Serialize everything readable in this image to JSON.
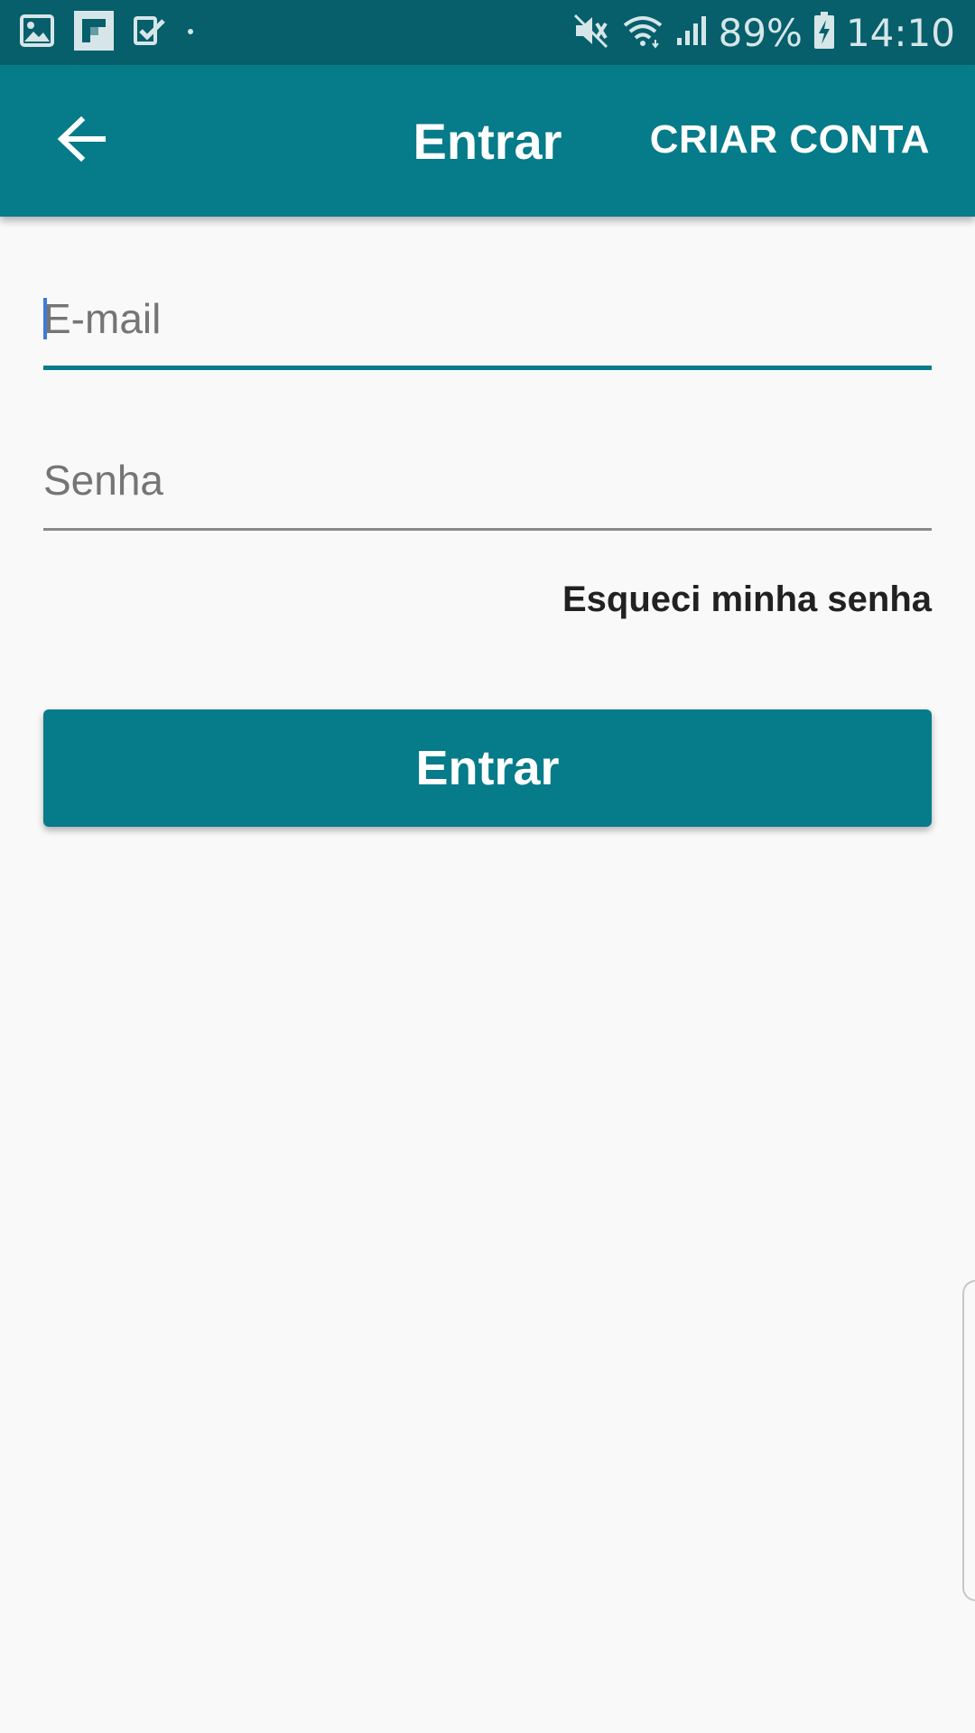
{
  "status_bar": {
    "battery": "89%",
    "time": "14:10",
    "icons": [
      "gallery-icon",
      "flipboard-icon",
      "check-icon",
      "dot-icon",
      "mute-icon",
      "wifi-icon",
      "signal-icon",
      "battery-charging-icon"
    ]
  },
  "app_bar": {
    "title": "Entrar",
    "action_label": "CRIAR CONTA",
    "back_icon": "arrow-left-icon"
  },
  "form": {
    "email_placeholder": "E-mail",
    "email_value": "",
    "password_placeholder": "Senha",
    "password_value": "",
    "forgot_label": "Esqueci minha senha",
    "submit_label": "Entrar"
  },
  "colors": {
    "status_bar": "#065f6b",
    "primary": "#067b89",
    "background": "#f9f9f9",
    "cursor": "#3d7bd9"
  }
}
